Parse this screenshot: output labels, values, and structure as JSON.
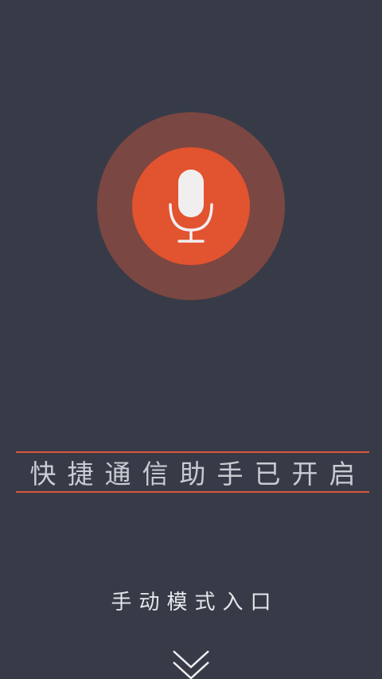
{
  "voice_button": {
    "icon": "microphone-icon",
    "colors": {
      "outer_ring": "#7b4742",
      "inner_circle": "#e2532f",
      "icon": "#f1eef0"
    }
  },
  "status_banner": {
    "text": "快捷通信助手已开启",
    "line_color": "#d8553a"
  },
  "manual_mode": {
    "label": "手动模式入口",
    "icon": "double-chevron-down-icon"
  },
  "background_color": "#373b48"
}
